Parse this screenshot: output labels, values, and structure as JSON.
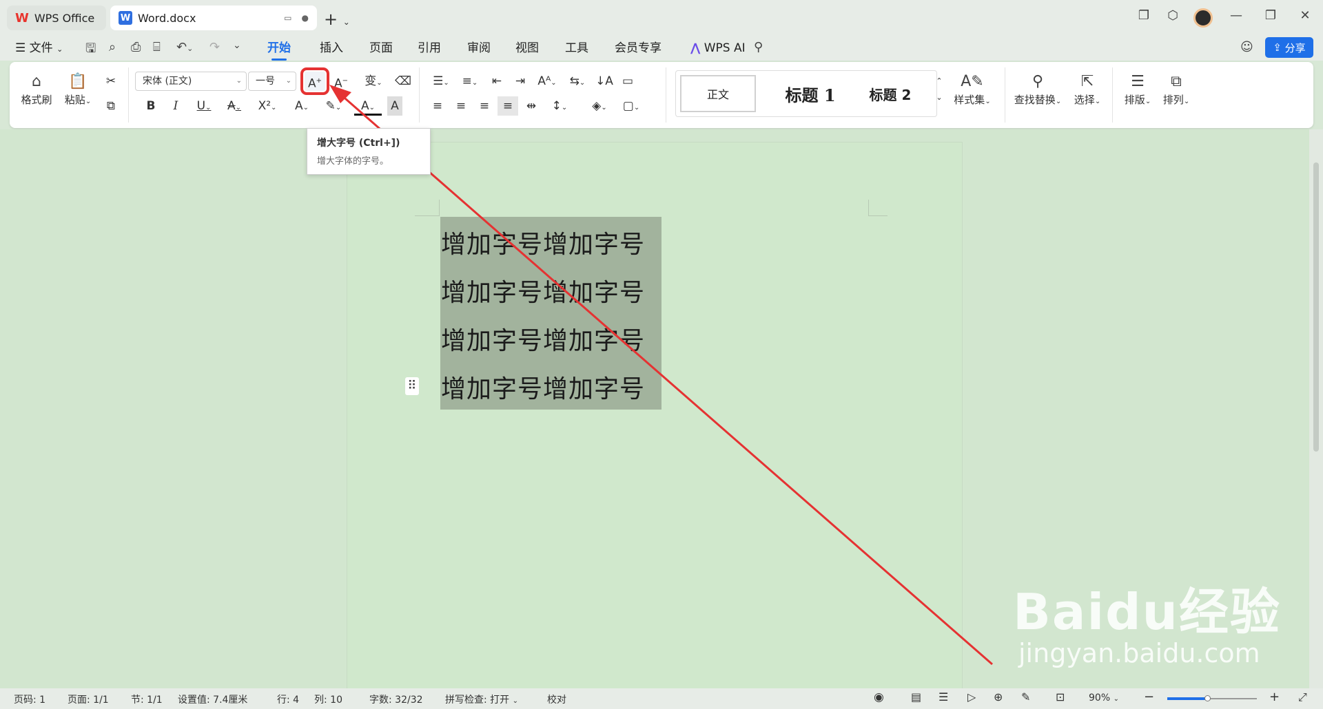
{
  "tabs": {
    "office": "WPS Office",
    "doc": "Word.docx"
  },
  "menu": {
    "file": "文件",
    "items": [
      "开始",
      "插入",
      "页面",
      "引用",
      "审阅",
      "视图",
      "工具",
      "会员专享"
    ],
    "ai": "WPS AI",
    "share": "分享"
  },
  "ribbon": {
    "format_painter": "格式刷",
    "paste": "粘贴",
    "font_name": "宋体 (正文)",
    "font_size": "一号",
    "styles": [
      "正文",
      "标题 1",
      "标题 2"
    ],
    "style_set": "样式集",
    "find_replace": "查找替换",
    "select": "选择",
    "layout": "排版",
    "arrange": "排列"
  },
  "tooltip": {
    "title": "增大字号 (Ctrl+])",
    "desc": "增大字体的字号。"
  },
  "document": {
    "lines": [
      "增加字号增加字号",
      "增加字号增加字号",
      "增加字号增加字号",
      "增加字号增加字号"
    ]
  },
  "status": {
    "page_code": "页码: 1",
    "page": "页面: 1/1",
    "section": "节: 1/1",
    "position": "设置值: 7.4厘米",
    "row": "行: 4",
    "col": "列: 10",
    "words": "字数: 32/32",
    "spell": "拼写检查: 打开",
    "proof": "校对",
    "zoom": "90%"
  },
  "watermark": {
    "brand": "Baidu经验",
    "url": "jingyan.baidu.com"
  },
  "colors": {
    "accent": "#1f6fe8",
    "highlight": "#e53232",
    "arrow": "#e53232"
  }
}
